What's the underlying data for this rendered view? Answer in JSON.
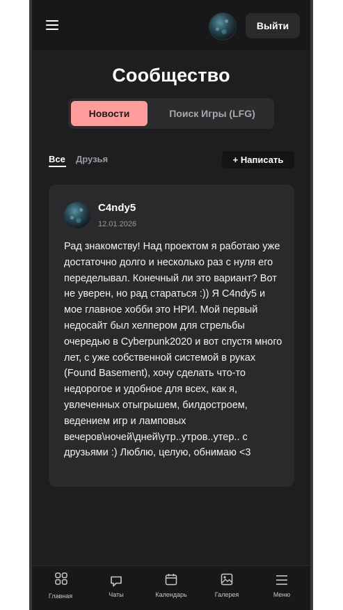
{
  "header": {
    "logout_label": "Выйти"
  },
  "page_title": "Сообщество",
  "tabs": [
    {
      "label": "Новости",
      "active": true
    },
    {
      "label": "Поиск Игры (LFG)",
      "active": false
    }
  ],
  "filters": {
    "all_label": "Все",
    "friends_label": "Друзья",
    "write_label": "+ Написать"
  },
  "post": {
    "author": "C4ndy5",
    "date": "12.01.2026",
    "text": "Рад знакомству! Над проектом я работаю уже достаточно долго и несколько раз с нуля его переделывал. Конечный ли это вариант? Вот не уверен, но рад стараться :)) Я C4ndy5 и мое главное хобби это НРИ. Мой первый недосайт был хелпером для стрельбы очередью в Cyberpunk2020 и вот спустя много лет, с уже собственной системой в руках (Found Basement), хочу сделать что-то недорогое и удобное для всех, как я, увлеченных отыгрышем, билдостроем, ведением игр и ламповых вечеров\\ночей\\дней\\утр..утров..утер.. с друзьями :) Люблю, целую, обнимаю <3"
  },
  "bottom_nav": [
    {
      "label": "Главная",
      "icon": "grid-icon"
    },
    {
      "label": "Чаты",
      "icon": "chat-icon"
    },
    {
      "label": "Календарь",
      "icon": "calendar-icon"
    },
    {
      "label": "Галерея",
      "icon": "image-icon"
    },
    {
      "label": "Меню",
      "icon": "menu-icon"
    }
  ],
  "colors": {
    "accent": "#ff9d9d",
    "background": "#1e1e20",
    "card": "#2a2a2d"
  }
}
